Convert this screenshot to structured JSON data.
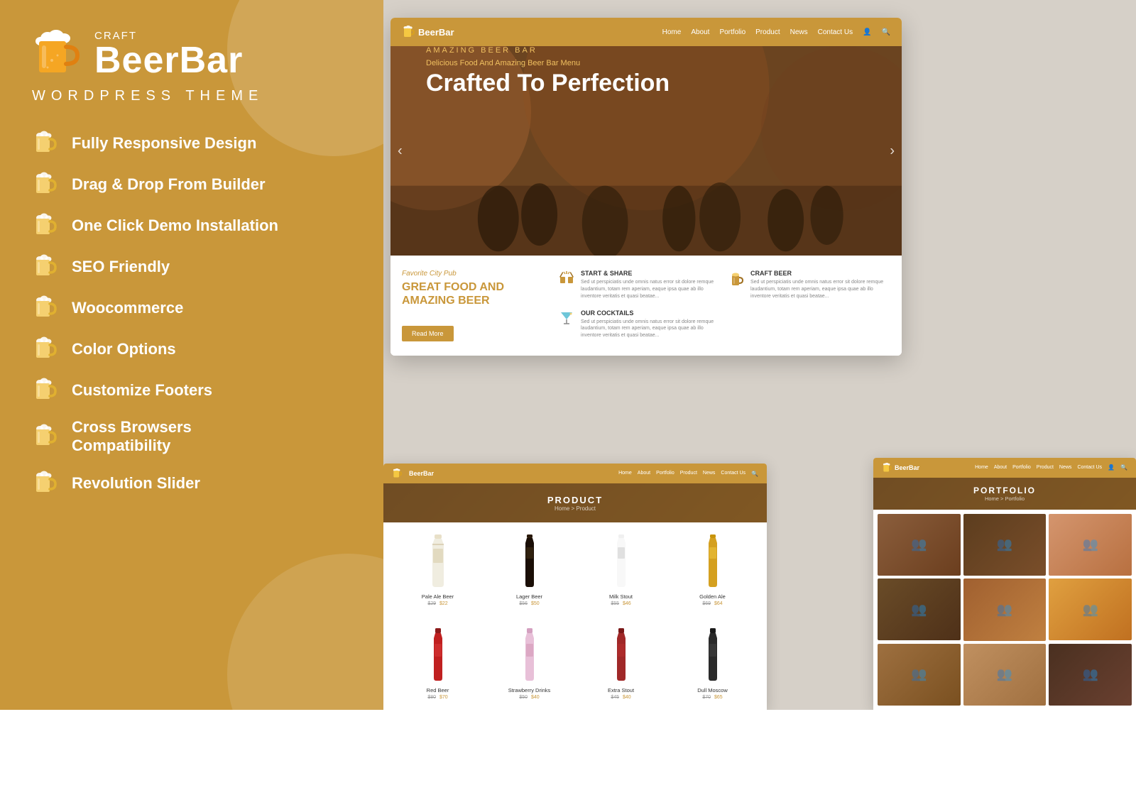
{
  "brand": {
    "craft_label": "Craft",
    "name": "BeerBar",
    "theme_label": "WordPress Theme"
  },
  "features": [
    {
      "id": "responsive",
      "label": "Fully Responsive Design"
    },
    {
      "id": "drag-drop",
      "label": "Drag & Drop From Builder"
    },
    {
      "id": "demo-install",
      "label": "One Click Demo Installation"
    },
    {
      "id": "seo",
      "label": "SEO Friendly"
    },
    {
      "id": "woocommerce",
      "label": "Woocommerce"
    },
    {
      "id": "color-options",
      "label": "Color Options"
    },
    {
      "id": "footers",
      "label": "Customize Footers"
    },
    {
      "id": "cross-browser",
      "label": "Cross Browsers Compatibility"
    },
    {
      "id": "revolution",
      "label": "Revolution Slider"
    }
  ],
  "main_mockup": {
    "nav": {
      "logo": "BeerBar",
      "links": [
        "Home",
        "About",
        "Portfolio",
        "Product",
        "News",
        "Contact Us"
      ]
    },
    "hero": {
      "small_label": "AMAZING BEER BAR",
      "tagline": "Delicious Food And Amazing Beer Bar Menu",
      "title": "Crafted To Perfection"
    },
    "content": {
      "pub_label": "Favorite City Pub",
      "heading_line1": "GREAT FOOD AND",
      "heading_line2": "AMAZING BEER",
      "cta_button": "Read More",
      "features": [
        {
          "title": "START & SHARE",
          "text": "Sed ut perspiciatis unde omnis natus error sit dolore remque laudantium, totam rem aperiam, eaque ipsa quae ab illo inventore veritatis et quasi beatae..."
        },
        {
          "title": "CRAFT BEER",
          "text": "Sed ut perspiciatis unde omnis natus error sit dolore remque laudantium, totam rem aperiam, eaque ipsa quae ab illo inventore veritatis et quasi beatae..."
        },
        {
          "title": "OUR COCKTAILS",
          "text": "Sed ut perspiciatis unde omnis natus error sit dolore remque laudantium, totam rem aperiam, eaque ipsa quae ab illo inventore veritatis et quasi beatae..."
        }
      ]
    }
  },
  "product_mockup": {
    "hero_title": "PRODUCT",
    "breadcrumb": "Home > Product",
    "products_row1": [
      {
        "name": "Pale Ale Beer",
        "price": "$22",
        "old_price": "$29"
      },
      {
        "name": "Lager Beer",
        "price": "$50",
        "old_price": "$56"
      },
      {
        "name": "Milk Stout",
        "price": "$46",
        "old_price": "$55"
      },
      {
        "name": "Golden Ale",
        "price": "$64",
        "old_price": "$69"
      }
    ],
    "products_row2": [
      {
        "name": "Red Beer",
        "price": "$70",
        "old_price": "$80"
      },
      {
        "name": "Strawberry Drinks",
        "price": "$40",
        "old_price": "$50"
      },
      {
        "name": "Extra Stout",
        "price": "$40",
        "old_price": "$45"
      },
      {
        "name": "Dull Moscow",
        "price": "$65",
        "old_price": "$70"
      }
    ]
  },
  "portfolio_mockup": {
    "hero_title": "PORTFOLIO",
    "breadcrumb": "Home > Portfolio"
  },
  "colors": {
    "brand_bg": "#c9973a",
    "white": "#ffffff",
    "dark": "#222222"
  }
}
